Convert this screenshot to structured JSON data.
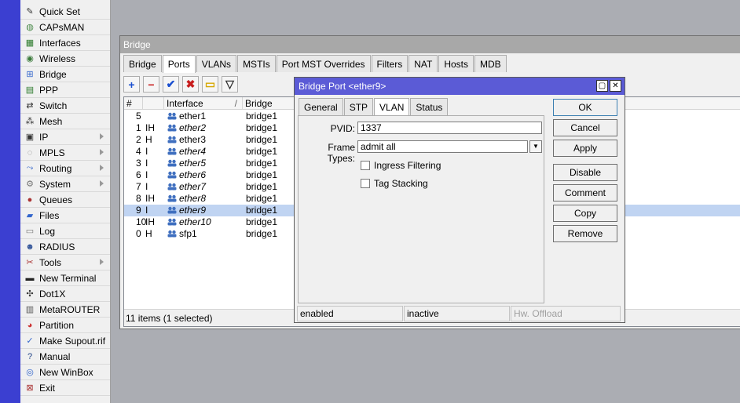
{
  "sidebar": {
    "items": [
      {
        "label": "Quick Set",
        "icon": "wand-icon",
        "glyph": "✎",
        "color": "#333",
        "arrow": false
      },
      {
        "label": "CAPsMAN",
        "icon": "capsman-icon",
        "glyph": "◍",
        "color": "#4a8a4a",
        "arrow": false
      },
      {
        "label": "Interfaces",
        "icon": "interfaces-icon",
        "glyph": "▦",
        "color": "#2a7a2a",
        "arrow": false
      },
      {
        "label": "Wireless",
        "icon": "wireless-icon",
        "glyph": "◉",
        "color": "#3a7a3a",
        "arrow": false
      },
      {
        "label": "Bridge",
        "icon": "bridge-icon",
        "glyph": "⊞",
        "color": "#3366cc",
        "arrow": false
      },
      {
        "label": "PPP",
        "icon": "ppp-icon",
        "glyph": "▤",
        "color": "#2a7a2a",
        "arrow": false
      },
      {
        "label": "Switch",
        "icon": "switch-icon",
        "glyph": "⇄",
        "color": "#333",
        "arrow": false
      },
      {
        "label": "Mesh",
        "icon": "mesh-icon",
        "glyph": "⁂",
        "color": "#333",
        "arrow": false
      },
      {
        "label": "IP",
        "icon": "ip-icon",
        "glyph": "▣",
        "color": "#333",
        "arrow": true
      },
      {
        "label": "MPLS",
        "icon": "mpls-icon",
        "glyph": "◌",
        "color": "#777",
        "arrow": true
      },
      {
        "label": "Routing",
        "icon": "routing-icon",
        "glyph": "⤳",
        "color": "#3366cc",
        "arrow": true
      },
      {
        "label": "System",
        "icon": "system-gear-icon",
        "glyph": "⚙",
        "color": "#777",
        "arrow": true
      },
      {
        "label": "Queues",
        "icon": "queues-icon",
        "glyph": "●",
        "color": "#a33",
        "arrow": false
      },
      {
        "label": "Files",
        "icon": "files-icon",
        "glyph": "▰",
        "color": "#3366cc",
        "arrow": false
      },
      {
        "label": "Log",
        "icon": "log-icon",
        "glyph": "▭",
        "color": "#777",
        "arrow": false
      },
      {
        "label": "RADIUS",
        "icon": "radius-icon",
        "glyph": "☻",
        "color": "#335599",
        "arrow": false
      },
      {
        "label": "Tools",
        "icon": "tools-icon",
        "glyph": "✂",
        "color": "#a33",
        "arrow": true
      },
      {
        "label": "New Terminal",
        "icon": "terminal-icon",
        "glyph": "▬",
        "color": "#222",
        "arrow": false
      },
      {
        "label": "Dot1X",
        "icon": "dot1x-icon",
        "glyph": "✣",
        "color": "#333",
        "arrow": false
      },
      {
        "label": "MetaROUTER",
        "icon": "metarouter-icon",
        "glyph": "▥",
        "color": "#555",
        "arrow": false
      },
      {
        "label": "Partition",
        "icon": "partition-icon",
        "glyph": "◕",
        "color": "#cc3333",
        "arrow": false
      },
      {
        "label": "Make Supout.rif",
        "icon": "supout-icon",
        "glyph": "✓",
        "color": "#3366cc",
        "arrow": false
      },
      {
        "label": "Manual",
        "icon": "manual-icon",
        "glyph": "?",
        "color": "#224488",
        "arrow": false
      },
      {
        "label": "New WinBox",
        "icon": "winbox-icon",
        "glyph": "◎",
        "color": "#3366cc",
        "arrow": false
      },
      {
        "label": "Exit",
        "icon": "exit-icon",
        "glyph": "⊠",
        "color": "#aa3333",
        "arrow": false
      }
    ]
  },
  "bridge_window": {
    "title": "Bridge",
    "tabs": [
      "Bridge",
      "Ports",
      "VLANs",
      "MSTIs",
      "Port MST Overrides",
      "Filters",
      "NAT",
      "Hosts",
      "MDB"
    ],
    "active_tab": "Ports",
    "toolbar": [
      {
        "name": "add-button",
        "glyph": "+",
        "color": "#1a4fd0"
      },
      {
        "name": "remove-button",
        "glyph": "−",
        "color": "#c81e1e"
      },
      {
        "name": "enable-button",
        "glyph": "✔",
        "color": "#1a4fd0"
      },
      {
        "name": "disable-button",
        "glyph": "✖",
        "color": "#c81e1e"
      },
      {
        "name": "comment-button",
        "glyph": "▭",
        "color": "#d6a800"
      },
      {
        "name": "filter-button",
        "glyph": "▽",
        "color": "#333"
      }
    ],
    "columns": [
      "#",
      "Interface",
      "Bridge"
    ],
    "sort_indicator": "/",
    "rows": [
      {
        "num": "5",
        "flags": "",
        "iface": "ether1",
        "bridge": "bridge1",
        "italic": false,
        "selected": false
      },
      {
        "num": "1",
        "flags": "IH",
        "iface": "ether2",
        "bridge": "bridge1",
        "italic": true,
        "selected": false
      },
      {
        "num": "2",
        "flags": "H",
        "iface": "ether3",
        "bridge": "bridge1",
        "italic": false,
        "selected": false
      },
      {
        "num": "4",
        "flags": "I",
        "iface": "ether4",
        "bridge": "bridge1",
        "italic": true,
        "selected": false
      },
      {
        "num": "3",
        "flags": "I",
        "iface": "ether5",
        "bridge": "bridge1",
        "italic": true,
        "selected": false
      },
      {
        "num": "6",
        "flags": "I",
        "iface": "ether6",
        "bridge": "bridge1",
        "italic": true,
        "selected": false
      },
      {
        "num": "7",
        "flags": "I",
        "iface": "ether7",
        "bridge": "bridge1",
        "italic": true,
        "selected": false
      },
      {
        "num": "8",
        "flags": "IH",
        "iface": "ether8",
        "bridge": "bridge1",
        "italic": true,
        "selected": false
      },
      {
        "num": "9",
        "flags": "I",
        "iface": "ether9",
        "bridge": "bridge1",
        "italic": true,
        "selected": true
      },
      {
        "num": "10",
        "flags": "IH",
        "iface": "ether10",
        "bridge": "bridge1",
        "italic": true,
        "selected": false
      },
      {
        "num": "0",
        "flags": "H",
        "iface": "sfp1",
        "bridge": "bridge1",
        "italic": false,
        "selected": false
      }
    ],
    "status": "11 items (1 selected)"
  },
  "dialog": {
    "title": "Bridge Port <ether9>",
    "tabs": [
      "General",
      "STP",
      "VLAN",
      "Status"
    ],
    "active_tab": "VLAN",
    "pvid_label": "PVID:",
    "pvid_value": "1337",
    "frame_types_label": "Frame Types:",
    "frame_types_value": "admit all",
    "ingress_filtering_label": "Ingress Filtering",
    "ingress_filtering_checked": false,
    "tag_stacking_label": "Tag Stacking",
    "tag_stacking_checked": false,
    "status_enabled": "enabled",
    "status_state": "inactive",
    "status_hw": "Hw. Offload",
    "buttons": {
      "ok": "OK",
      "cancel": "Cancel",
      "apply": "Apply",
      "disable": "Disable",
      "comment": "Comment",
      "copy": "Copy",
      "remove": "Remove"
    }
  },
  "colors": {
    "strip": "#3b3fd1",
    "dialog_title": "#5b5bd6",
    "selection": "#c0d4f2",
    "iface_icon": "#3f6fbf"
  }
}
